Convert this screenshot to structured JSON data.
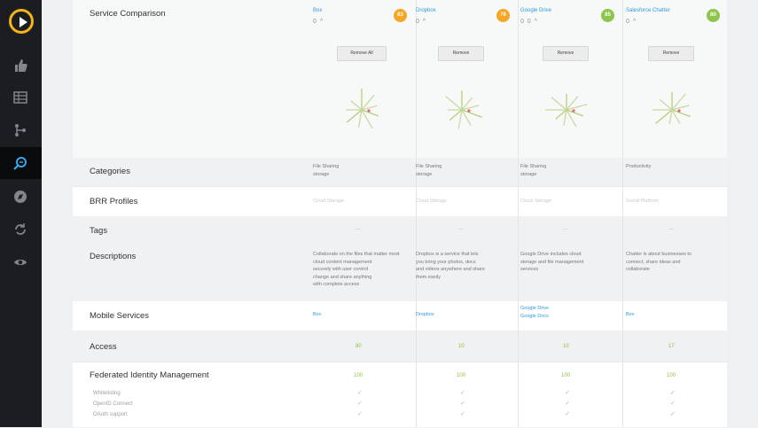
{
  "sidebar": {
    "items": [
      {
        "icon": "thumbs-up-icon"
      },
      {
        "icon": "grid-icon"
      },
      {
        "icon": "branch-icon"
      },
      {
        "icon": "search-compare-icon",
        "active": true
      },
      {
        "icon": "compass-icon"
      },
      {
        "icon": "sync-icon"
      },
      {
        "icon": "eye-icon"
      }
    ],
    "accent": "#f6b21b"
  },
  "comparison": {
    "title": "Service Comparison",
    "row_labels": {
      "categories": "Categories",
      "bfr_profiles": "BRR Profiles",
      "tags": "Tags",
      "descriptions": "Descriptions",
      "mobile_services": "Mobile Services",
      "access": "Access",
      "federated": "Federated Identity Management"
    },
    "federated_subrows": [
      "Whitelisting",
      "OpenID Connect",
      "OAuth support"
    ],
    "services": [
      {
        "name": "Box",
        "meta": "0 ^",
        "score": "83",
        "score_color": "#f5a623",
        "button": "Remove All",
        "categories": "File Sharing\nstorage",
        "bfr": "Cloud Storage",
        "tags": "—",
        "description": "Collaborate on the files that matter most\ncloud content management\nsecurely with user control\nchange and share anything\nwith complete access",
        "mobile": "Box",
        "access": "80",
        "federated": "100",
        "checks": [
          "✓",
          "✓",
          "✓"
        ]
      },
      {
        "name": "Dropbox",
        "meta": "0 ^",
        "score": "76",
        "score_color": "#f5a623",
        "button": "Remove",
        "categories": "File Sharing\nstorage",
        "bfr": "Cloud Storage",
        "tags": "—",
        "description": "Dropbox is a service that lets\nyou bring your photos, docs\nand videos anywhere and share\nthem easily",
        "mobile": "Dropbox",
        "access": "10",
        "federated": "100",
        "checks": [
          "✓",
          "✓",
          "✓"
        ]
      },
      {
        "name": "Google Drive",
        "meta": "0 0 ^",
        "score": "85",
        "score_color": "#8fc54a",
        "button": "Remove",
        "categories": "File Sharing\nstorage",
        "bfr": "Cloud Storage",
        "tags": "—",
        "description": "Google Drive includes cloud\nstorage and file management\nservices",
        "mobile": "Google Drive\nGoogle Docs",
        "access": "10",
        "federated": "100",
        "checks": [
          "✓",
          "✓",
          "✓"
        ]
      },
      {
        "name": "Salesforce Chatter",
        "meta": "0 ^",
        "score": "80",
        "score_color": "#8fc54a",
        "button": "Remove",
        "categories": "Productivity",
        "bfr": "Social Platform",
        "tags": "—",
        "description": "Chatter is about businesses to\nconnect, share ideas and\ncollaborate",
        "mobile": "Box",
        "access": "17",
        "federated": "100",
        "checks": [
          "✓",
          "✓",
          "✓"
        ]
      }
    ]
  }
}
